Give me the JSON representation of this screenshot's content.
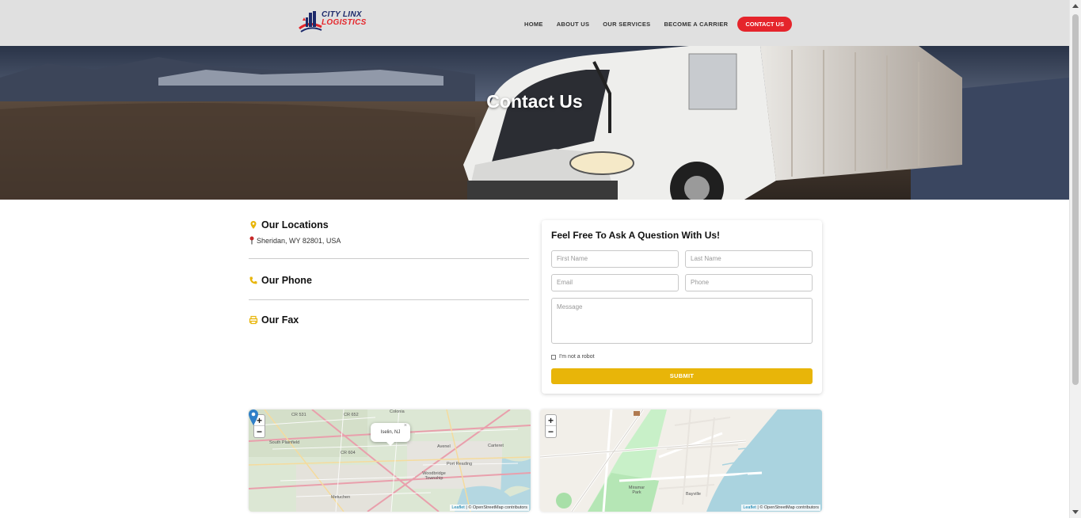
{
  "header": {
    "logo_line1": "CITY LINX",
    "logo_line2": "LOGISTICS",
    "nav": [
      {
        "label": "HOME"
      },
      {
        "label": "ABOUT US"
      },
      {
        "label": "OUR SERVICES"
      },
      {
        "label": "BECOME A CARRIER"
      }
    ],
    "contact_label": "CONTACT US"
  },
  "hero": {
    "title": "Contact Us"
  },
  "info": {
    "locations_heading": "Our Locations",
    "location_address": "Sheridan, WY 82801, USA",
    "phone_heading": "Our Phone",
    "fax_heading": "Our Fax"
  },
  "form": {
    "title": "Feel Free To Ask A Question With Us!",
    "first_name_placeholder": "First Name",
    "last_name_placeholder": "Last Name",
    "email_placeholder": "Email",
    "phone_placeholder": "Phone",
    "message_placeholder": "Message",
    "robot_label": "I'm not a robot",
    "submit_label": "SUBMIT"
  },
  "map1": {
    "popup_text": "Iselin, NJ",
    "close_symbol": "×",
    "zoom_in": "+",
    "zoom_out": "−",
    "attribution_leaflet": "Leaflet",
    "attribution_osm": "| © OpenStreetMap contributors",
    "labels": [
      "CR 531",
      "CR 652",
      "Colonia",
      "South Plainfield",
      "Avenel",
      "Carteret",
      "CR 604",
      "Port Reading",
      "Woodbridge Township",
      "Metuchen"
    ]
  },
  "map2": {
    "zoom_in": "+",
    "zoom_out": "−",
    "attribution_leaflet": "Leaflet",
    "attribution_osm": "| © OpenStreetMap contributors",
    "labels": [
      "Miramar Park",
      "Bayville"
    ]
  },
  "colors": {
    "accent_red": "#e5242b",
    "accent_yellow": "#e8b509",
    "header_bg": "#e0e0e0"
  },
  "icons": {
    "location": "map-pin-icon",
    "phone": "phone-icon",
    "fax": "printer-icon"
  }
}
